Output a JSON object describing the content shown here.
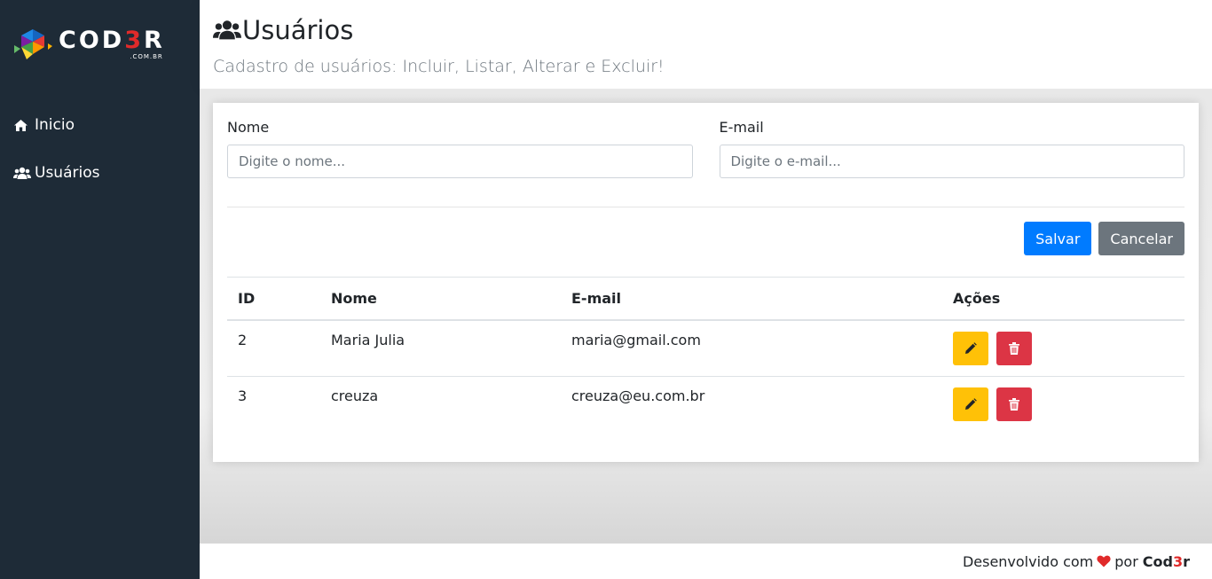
{
  "brand": {
    "logo_word_a": "COD",
    "logo_word_b": "3",
    "logo_word_c": "R",
    "logo_sub": ".COM.BR"
  },
  "sidebar": {
    "items": [
      {
        "label": "Inicio",
        "icon": "home-icon"
      },
      {
        "label": "Usuários",
        "icon": "users-icon"
      }
    ]
  },
  "header": {
    "title": "Usuários",
    "subtitle": "Cadastro de usuários: Incluir, Listar, Alterar e Excluir!"
  },
  "form": {
    "name_label": "Nome",
    "name_placeholder": "Digite o nome...",
    "name_value": "",
    "email_label": "E-mail",
    "email_placeholder": "Digite o e-mail...",
    "email_value": "",
    "save_label": "Salvar",
    "cancel_label": "Cancelar"
  },
  "table": {
    "headers": [
      "ID",
      "Nome",
      "E-mail",
      "Ações"
    ],
    "rows": [
      {
        "id": "2",
        "nome": "Maria Julia",
        "email": "maria@gmail.com"
      },
      {
        "id": "3",
        "nome": "creuza",
        "email": "creuza@eu.com.br"
      }
    ]
  },
  "footer": {
    "text": "Desenvolvido com",
    "por": "por",
    "brand_a": "Cod",
    "brand_b": "3",
    "brand_c": "r"
  },
  "colors": {
    "sidebar_bg": "#1e2b37",
    "primary": "#007bff",
    "secondary": "#6c757d",
    "warning": "#ffc107",
    "danger": "#dc3545",
    "heart": "#e02a2a"
  }
}
